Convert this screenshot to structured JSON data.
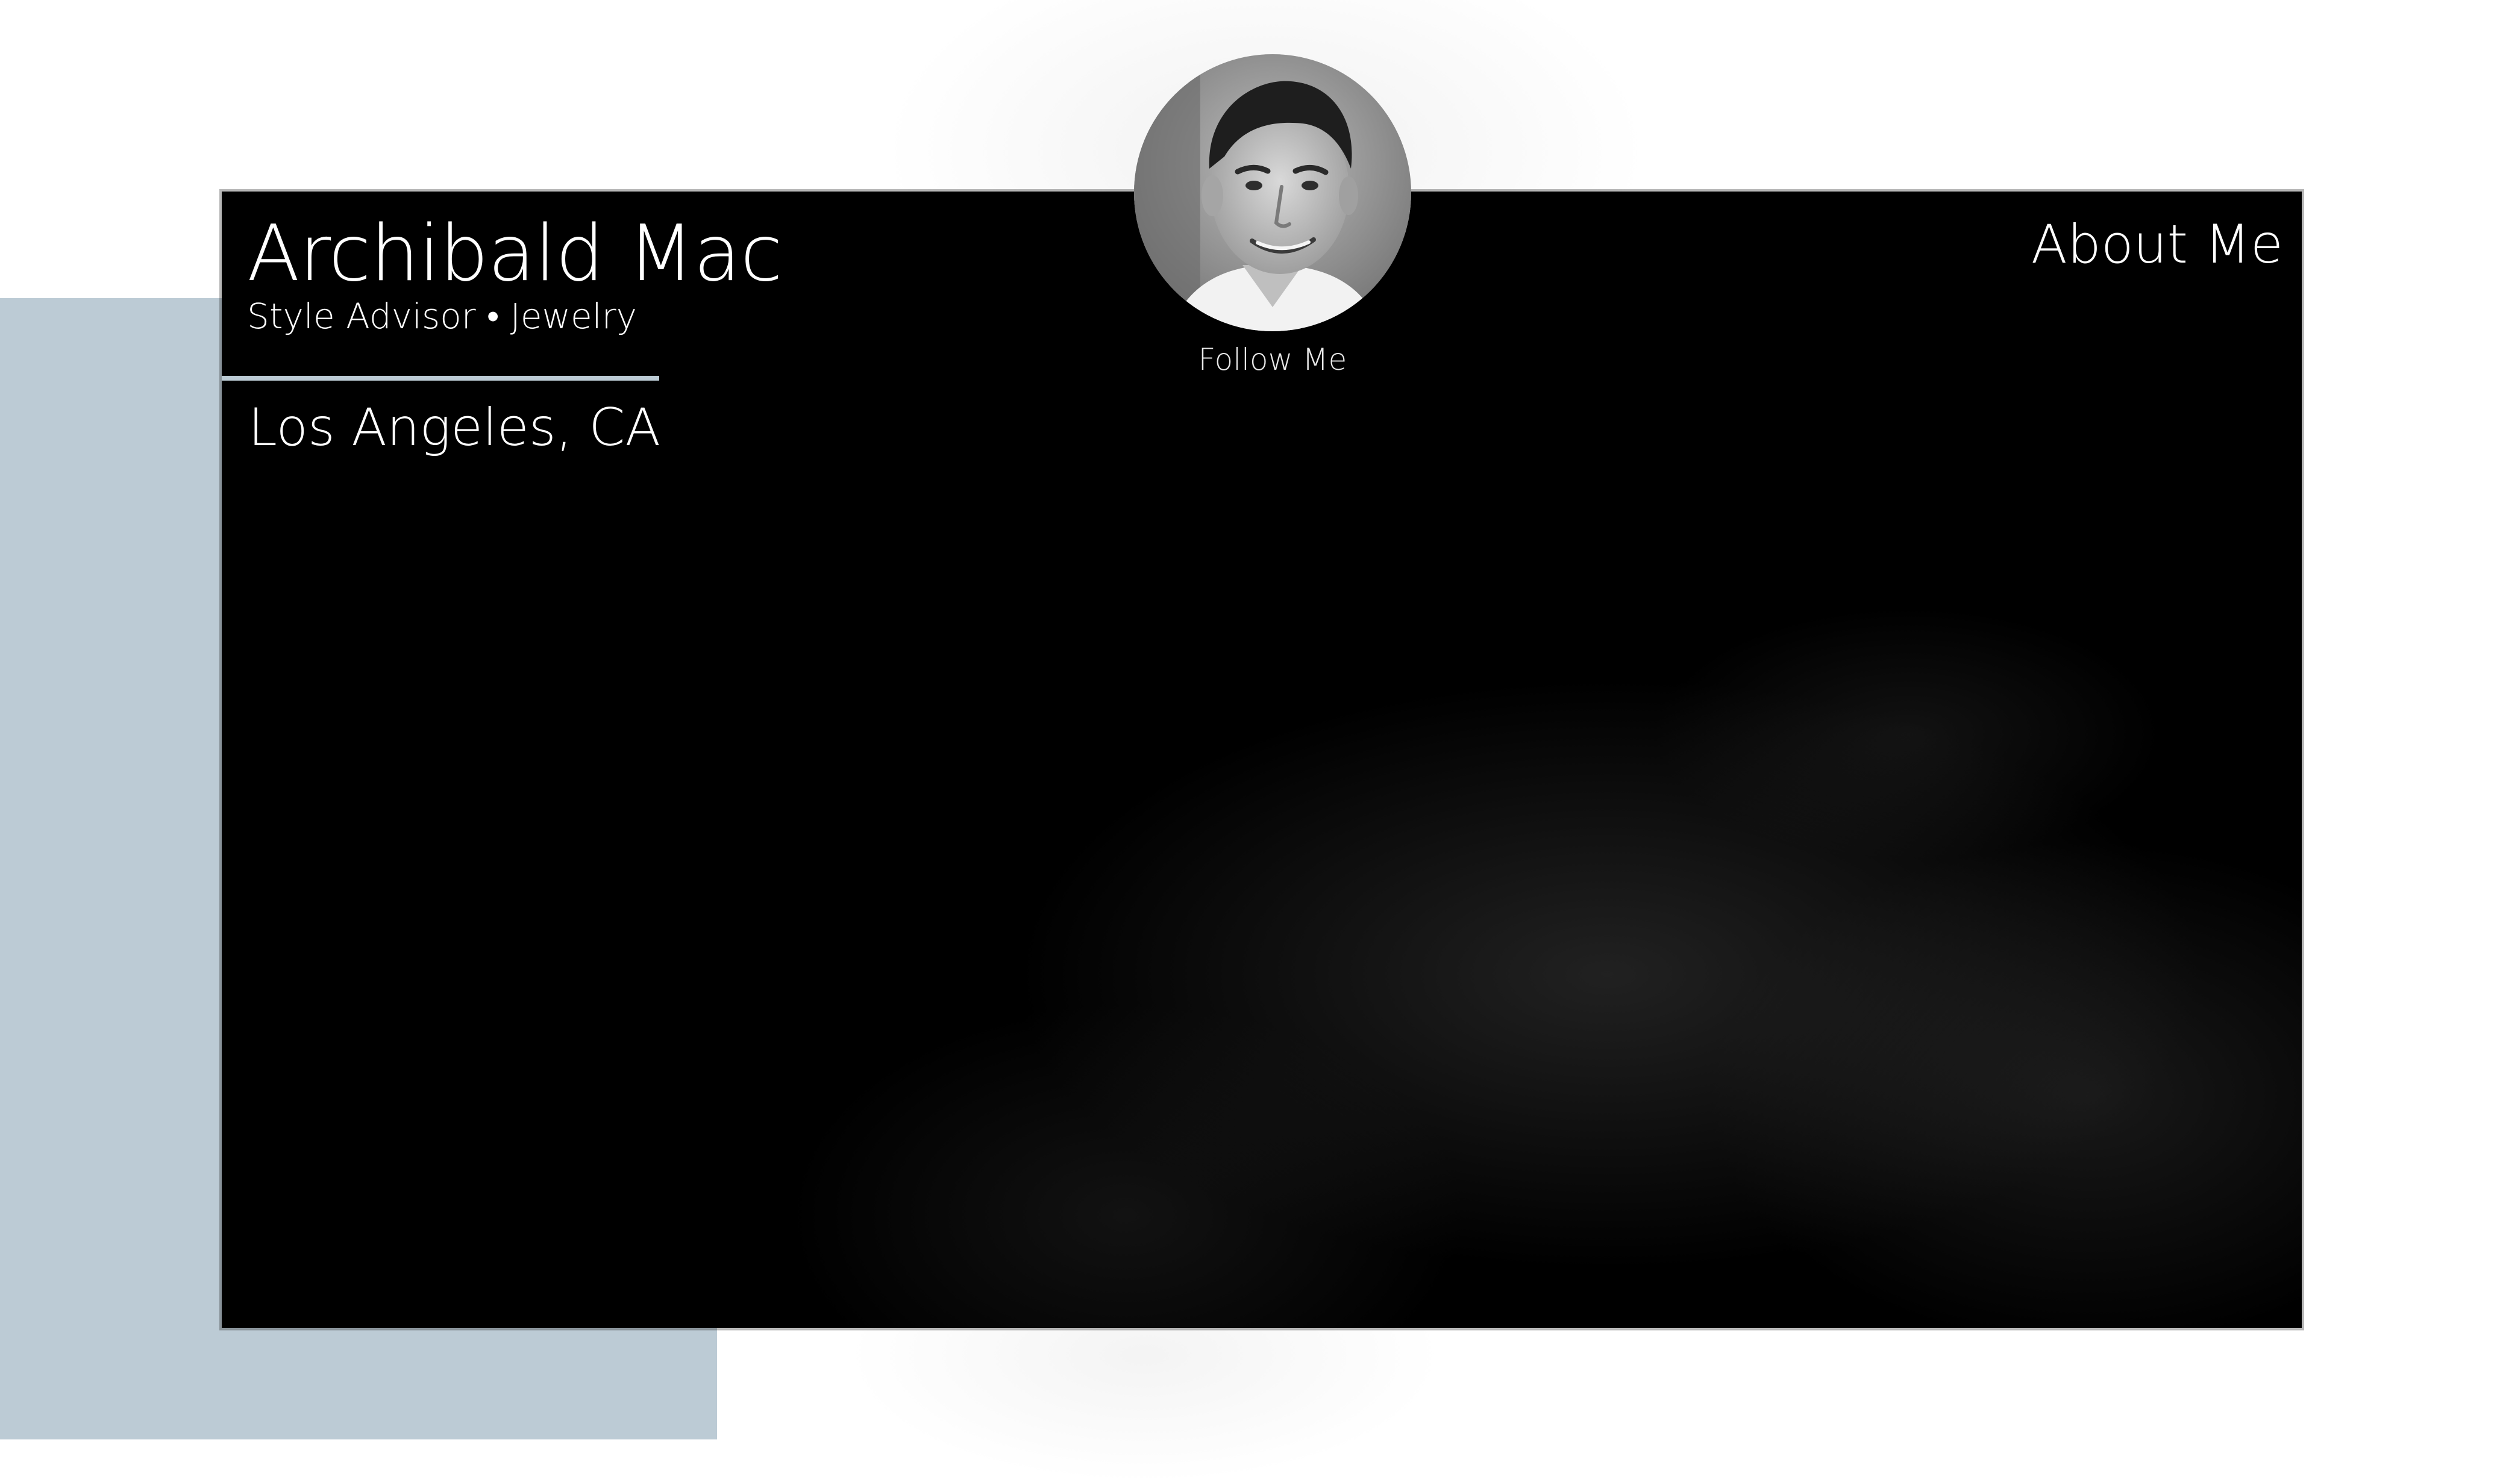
{
  "profile": {
    "name": "Archibald Mac",
    "title": "Style Advisor • Jewelry",
    "location": "Los Angeles, CA",
    "follow_label": "Follow Me",
    "avatar_icon": "portrait-photo"
  },
  "nav": {
    "about_label": "About Me"
  },
  "colors": {
    "accent": "#bccbd5",
    "panel": "#000000",
    "text": "#ffffff"
  }
}
